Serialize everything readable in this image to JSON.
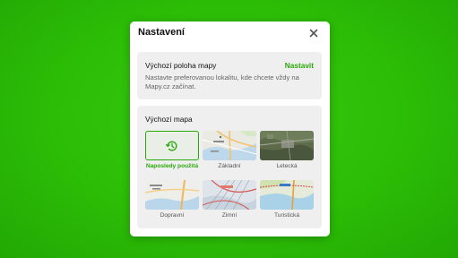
{
  "dialog": {
    "title": "Nastavení",
    "close_icon": "close-icon"
  },
  "location": {
    "title": "Výchozí poloha mapy",
    "action": "Nastavit",
    "description": "Nastavte preferovanou lokalitu, kde chcete vždy na Mapy.cz začínat."
  },
  "default_map": {
    "title": "Výchozí mapa",
    "options": [
      {
        "label": "Naposledy použitá",
        "icon": "history-icon",
        "selected": true
      },
      {
        "label": "Základní",
        "selected": false
      },
      {
        "label": "Letecká",
        "selected": false
      },
      {
        "label": "Dopravní",
        "selected": false
      },
      {
        "label": "Zimní",
        "selected": false
      },
      {
        "label": "Turistická",
        "selected": false
      }
    ]
  },
  "colors": {
    "background": "#2cbd06",
    "accent": "#2aa90a"
  }
}
